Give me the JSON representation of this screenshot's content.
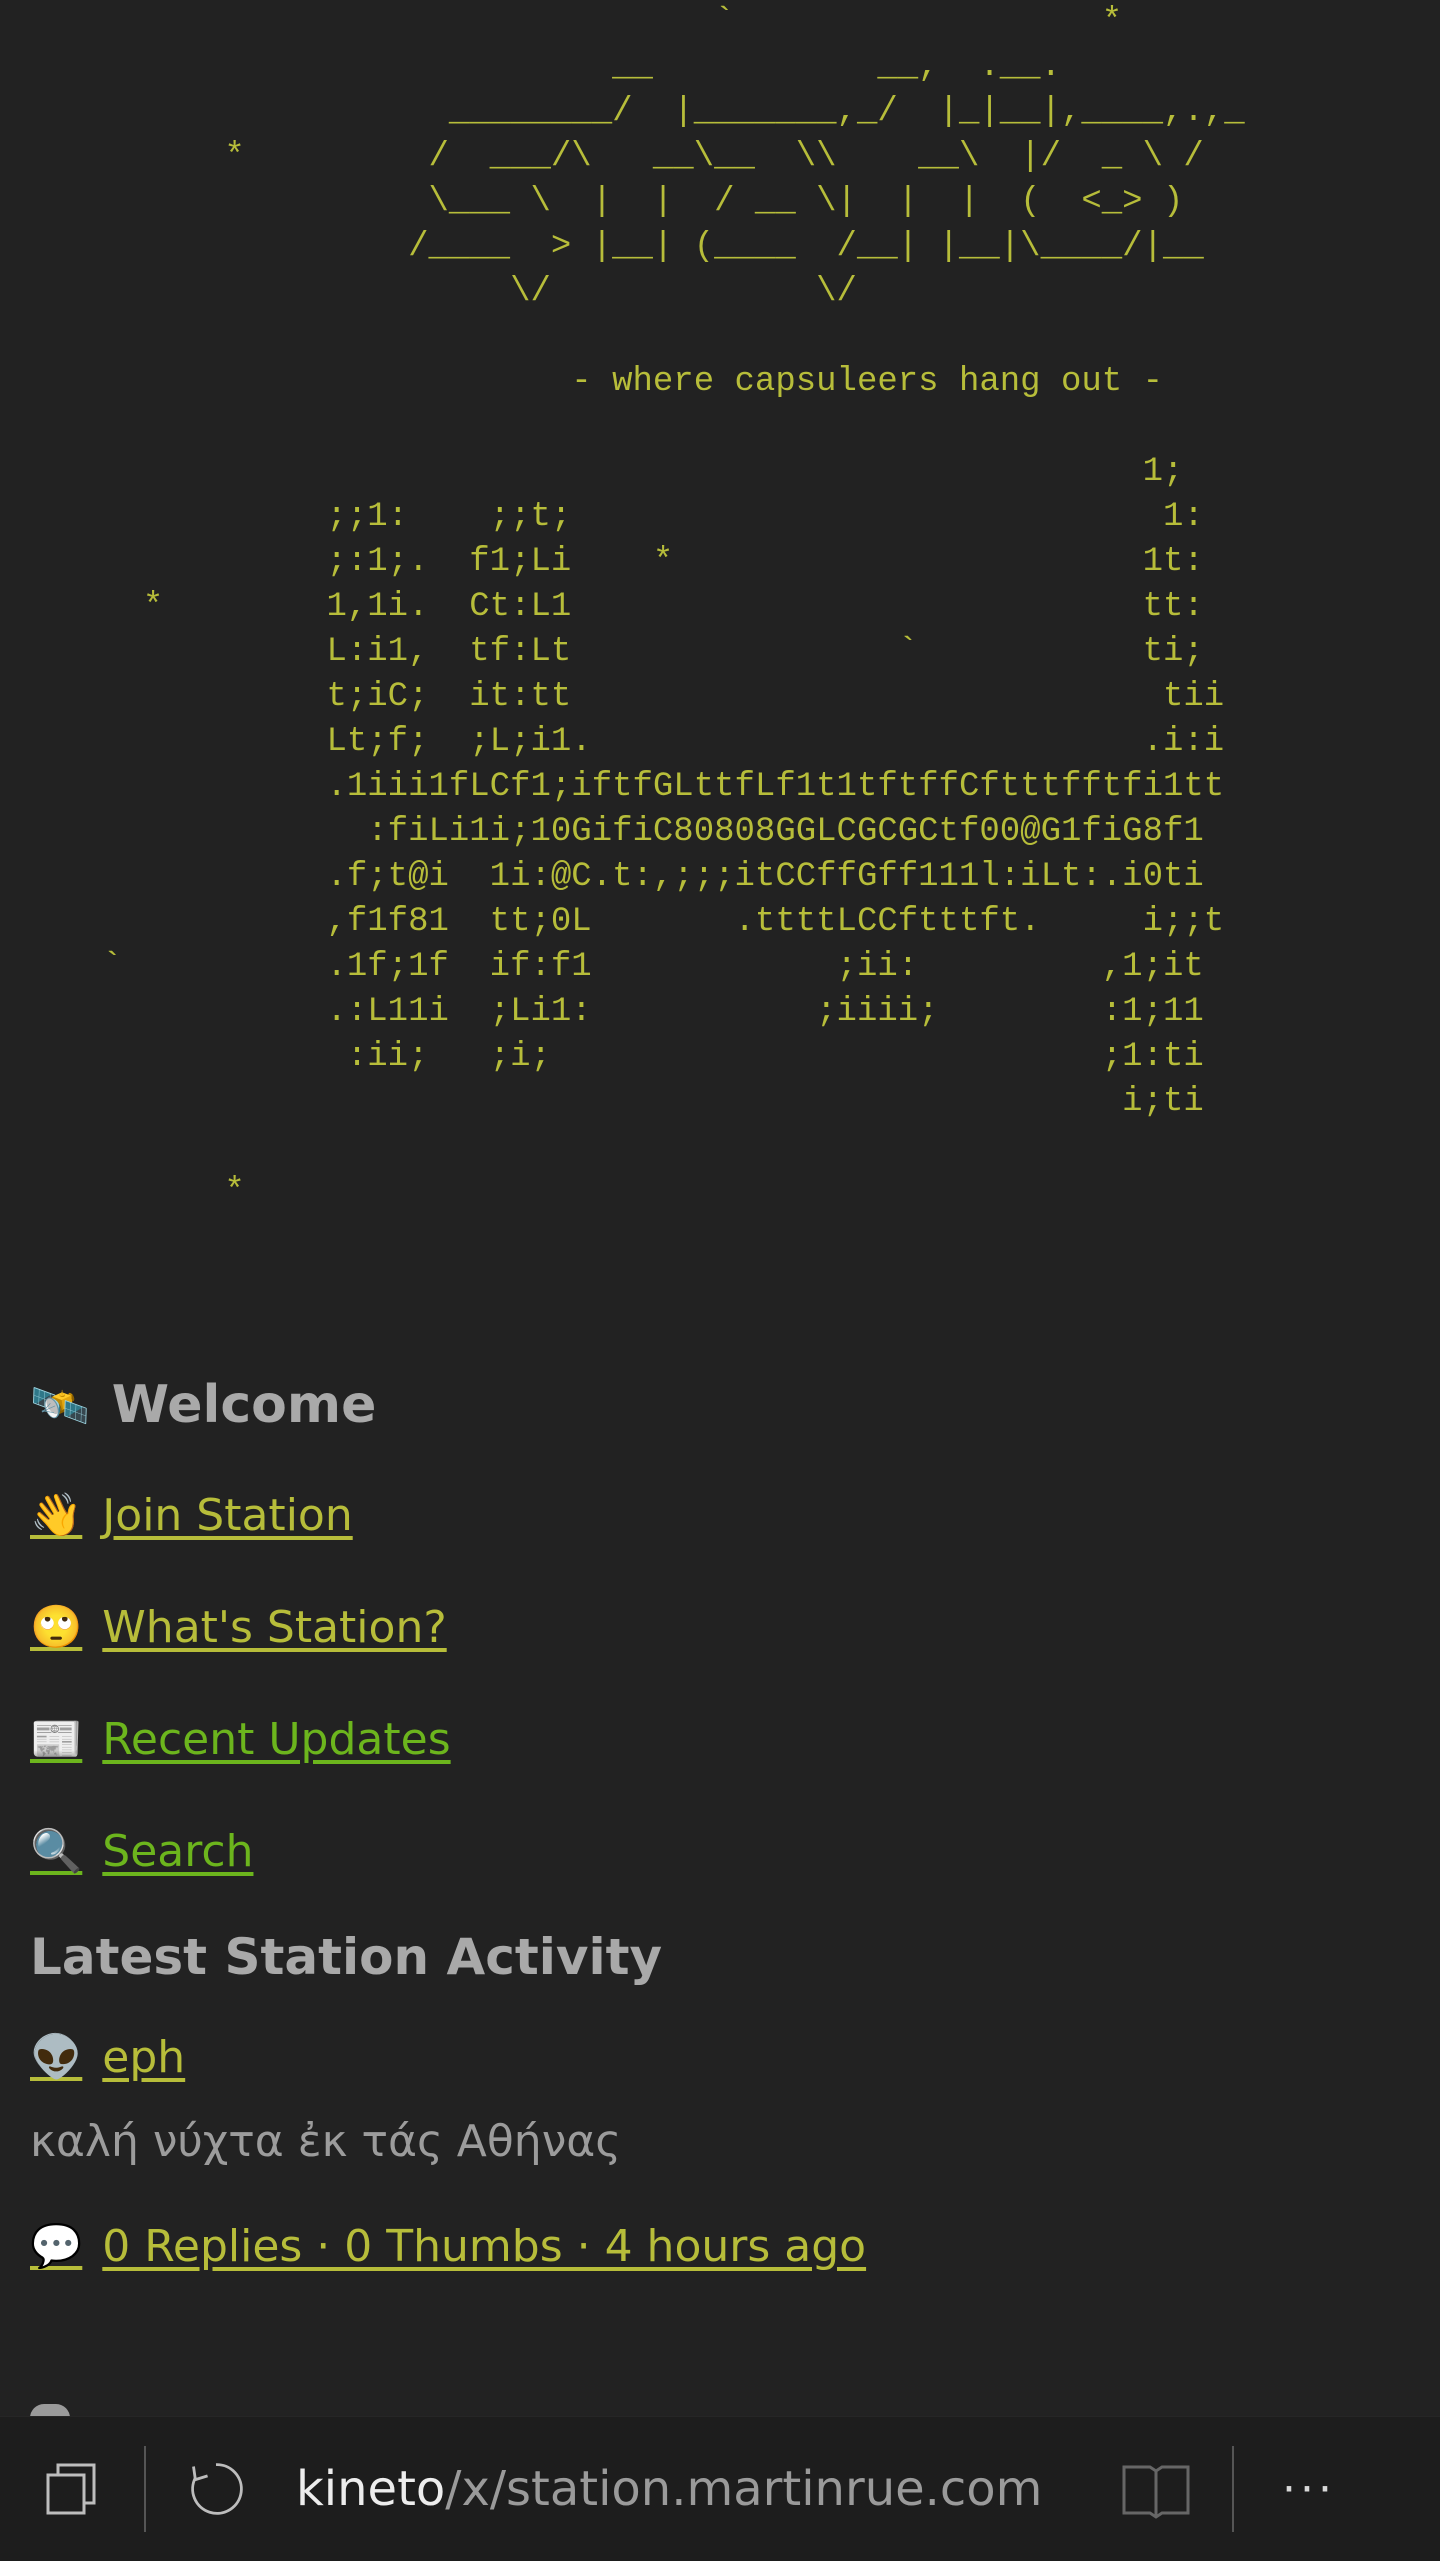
{
  "ascii_art": {
    "lines": [
      "                                   `                  *",
      "                              __           __,  .__.",
      "                      ________/  |_______,_/  |_|__|,____,.,_",
      "           *         /  ___/\\   __\\__  \\\\    __\\  |/  _ \\ /",
      "                     \\___ \\  |  |  / __ \\|  |  |  (  <_> )",
      "                    /____  > |__| (____  /__| |__|\\____/|__",
      "                         \\/             \\/",
      "",
      "                            - where capsuleers hang out -",
      "",
      "                                                        1;",
      "                ;;1:    ;;t;                             1:",
      "                ;:1;.  f1;Li    *                       1t:",
      "       *        1,1i.  Ct:L1                            tt:",
      "                L:i1,  tf:Lt                `           ti;",
      "                t;iC;  it:tt                             tii",
      "                Lt;f;  ;L;i1.                           .i:i",
      "                .1iii1fLCf1;iftfGLttfLf1t1tftffCftttfftfi1tt",
      "                  :fiLi1i;10GifiC80808GGLCGCGCtf00@G1fiG8f1",
      "                .f;t@i  1i:@C.t:,;;;itCCffGff111l:iLt:.i0ti",
      "                ,f1f81  tt;0L       .ttttLCCftttft.     i;;t",
      "     `          .1f;1f  if:f1            ;ii:         ,1;it",
      "                .:L11i  ;Li1:           ;iiii;        :1;11",
      "                 :ii;   ;i;                           ;1:ti",
      "                                                       i;ti",
      "",
      "           *"
    ]
  },
  "welcome": {
    "icon": "satellite-icon",
    "title": "Welcome"
  },
  "nav_links": [
    {
      "icon": "waving-hand-icon",
      "label": "Join Station",
      "color": "#b7bd3a"
    },
    {
      "icon": "rolling-eyes-face-icon",
      "label": "What's Station?",
      "color": "#b7bd3a"
    },
    {
      "icon": "newspaper-icon",
      "label": "Recent Updates",
      "color": "#6cb51d"
    },
    {
      "icon": "magnifying-glass-icon",
      "label": "Search",
      "color": "#6cb51d"
    }
  ],
  "activity": {
    "title": "Latest Station Activity",
    "post": {
      "author_icon": "alien-icon",
      "author": "eph",
      "text": "καλή νύχτα ἐκ τάς Αθήνας",
      "meta_icon": "speech-bubble-icon",
      "meta": "0 Replies · 0 Thumbs · 4 hours ago"
    }
  },
  "browser_bar": {
    "url_host": "kineto",
    "url_rest": "/x/station.martinrue.com",
    "icons": [
      "tabs-icon",
      "reload-icon",
      "reading-view-icon",
      "more-icon"
    ],
    "more_label": "···"
  },
  "colors": {
    "background": "#222222",
    "accent_yellow": "#b7bd3a",
    "accent_green": "#6cb51d",
    "text_gray": "#a9a9a9"
  }
}
